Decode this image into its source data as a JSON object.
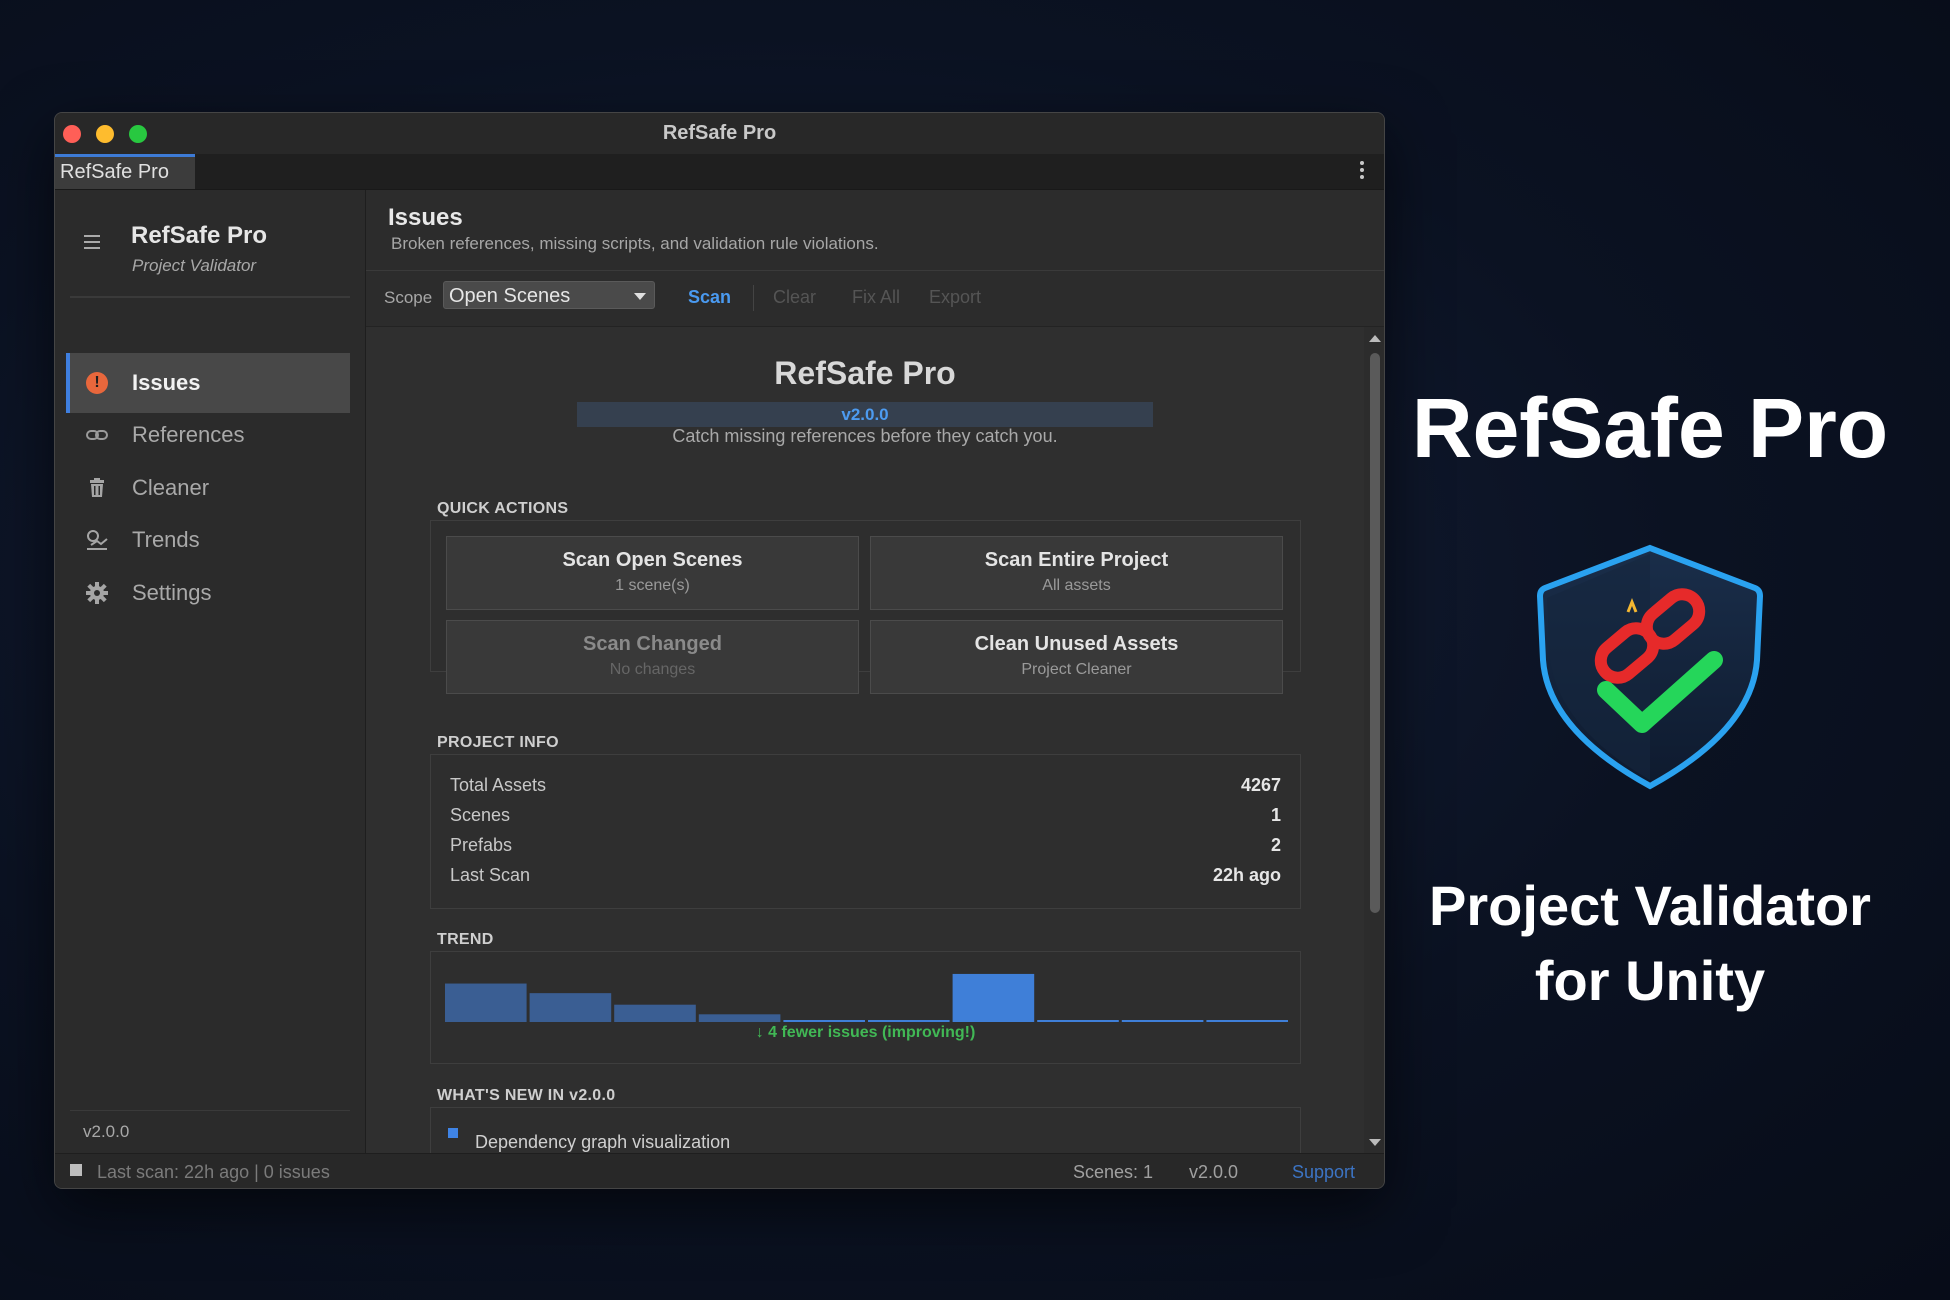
{
  "window": {
    "title": "RefSafe Pro",
    "tab": "RefSafe Pro"
  },
  "sidebar": {
    "app_name": "RefSafe Pro",
    "app_subtitle": "Project Validator",
    "items": [
      {
        "label": "Issues",
        "icon": "alert-icon",
        "active": true
      },
      {
        "label": "References",
        "icon": "link-icon"
      },
      {
        "label": "Cleaner",
        "icon": "trash-icon"
      },
      {
        "label": "Trends",
        "icon": "trend-icon"
      },
      {
        "label": "Settings",
        "icon": "gear-icon"
      }
    ],
    "version": "v2.0.0"
  },
  "main": {
    "title": "Issues",
    "subtitle": "Broken references, missing scripts, and validation rule violations."
  },
  "toolbar": {
    "scope_label": "Scope",
    "scope_value": "Open Scenes",
    "scan": "Scan",
    "clear": "Clear",
    "fix_all": "Fix All",
    "export": "Export"
  },
  "hero": {
    "title": "RefSafe Pro",
    "version": "v2.0.0",
    "tagline": "Catch missing references before they catch you."
  },
  "quick_actions": {
    "label": "QUICK ACTIONS",
    "buttons": [
      {
        "title": "Scan Open Scenes",
        "sub": "1 scene(s)",
        "enabled": true
      },
      {
        "title": "Scan Entire Project",
        "sub": "All assets",
        "enabled": true
      },
      {
        "title": "Scan Changed",
        "sub": "No changes",
        "enabled": false
      },
      {
        "title": "Clean Unused Assets",
        "sub": "Project Cleaner",
        "enabled": true
      }
    ]
  },
  "project_info": {
    "label": "PROJECT INFO",
    "rows": [
      {
        "key": "Total Assets",
        "value": "4267"
      },
      {
        "key": "Scenes",
        "value": "1"
      },
      {
        "key": "Prefabs",
        "value": "2"
      },
      {
        "key": "Last Scan",
        "value": "22h ago"
      }
    ]
  },
  "trend": {
    "label": "TREND",
    "note": "↓ 4 fewer issues (improving!)",
    "bar_color": "#3a5e93",
    "highlight_color": "#3f7fd8"
  },
  "chart_data": {
    "type": "bar",
    "values": [
      10,
      7.5,
      4.5,
      2,
      0.5,
      0.5,
      12.5,
      0.5,
      0.5,
      0.5
    ],
    "highlight_index": 6,
    "ylim": [
      0,
      13
    ]
  },
  "whats_new": {
    "label": "WHAT'S NEW IN v2.0.0",
    "items": [
      "Dependency graph visualization"
    ]
  },
  "statusbar": {
    "left": "Last scan: 22h ago | 0 issues",
    "scenes": "Scenes: 1",
    "version": "v2.0.0",
    "support": "Support"
  },
  "promo": {
    "title": "RefSafe Pro",
    "subtitle_line1": "Project Validator",
    "subtitle_line2": "for Unity"
  }
}
